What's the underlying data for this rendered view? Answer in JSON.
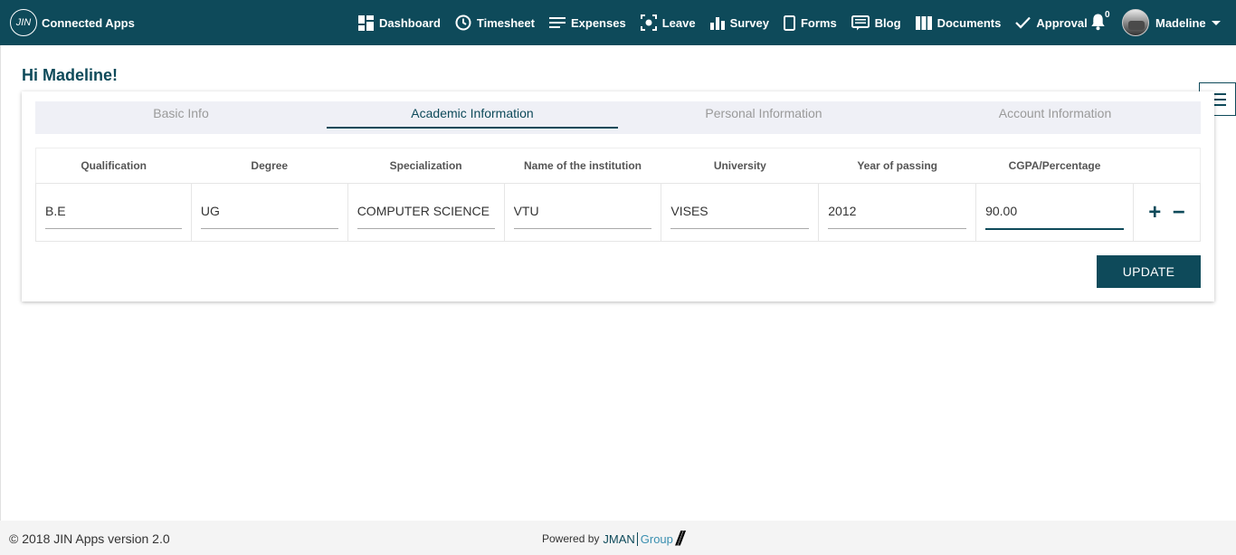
{
  "header": {
    "logo_text": "JIN",
    "app_name": "Connected Apps",
    "nav": [
      {
        "label": "Dashboard",
        "icon": "dashboard-icon"
      },
      {
        "label": "Timesheet",
        "icon": "clock-icon"
      },
      {
        "label": "Expenses",
        "icon": "list-icon"
      },
      {
        "label": "Leave",
        "icon": "leave-icon"
      },
      {
        "label": "Survey",
        "icon": "bar-chart-icon"
      },
      {
        "label": "Forms",
        "icon": "form-icon"
      },
      {
        "label": "Blog",
        "icon": "blog-icon"
      },
      {
        "label": "Documents",
        "icon": "documents-icon"
      },
      {
        "label": "Approval",
        "icon": "check-icon"
      }
    ],
    "notifications": "0",
    "user_name": "Madeline"
  },
  "greeting": "Hi Madeline!",
  "tabs": [
    {
      "label": "Basic Info"
    },
    {
      "label": "Academic Information"
    },
    {
      "label": "Personal Information"
    },
    {
      "label": "Account Information"
    }
  ],
  "table": {
    "columns": [
      "Qualification",
      "Degree",
      "Specialization",
      "Name of the institution",
      "University",
      "Year of passing",
      "CGPA/Percentage"
    ],
    "rows": [
      [
        "B.E",
        "UG",
        "COMPUTER SCIENCE",
        "VTU",
        "VISES",
        "2012",
        "90.00"
      ]
    ],
    "add_symbol": "+",
    "remove_symbol": "−"
  },
  "update_label": "UPDATE",
  "footer": {
    "copyright": "© 2018 JIN Apps version 2.0",
    "powered_by": "Powered by",
    "brand_1": "JMAN",
    "brand_2": "Group",
    "brand_mark": "//"
  },
  "colors": {
    "primary": "#0e4a5a",
    "tab_bg": "#eff0f6",
    "footer_bg": "#f4f4f4"
  }
}
